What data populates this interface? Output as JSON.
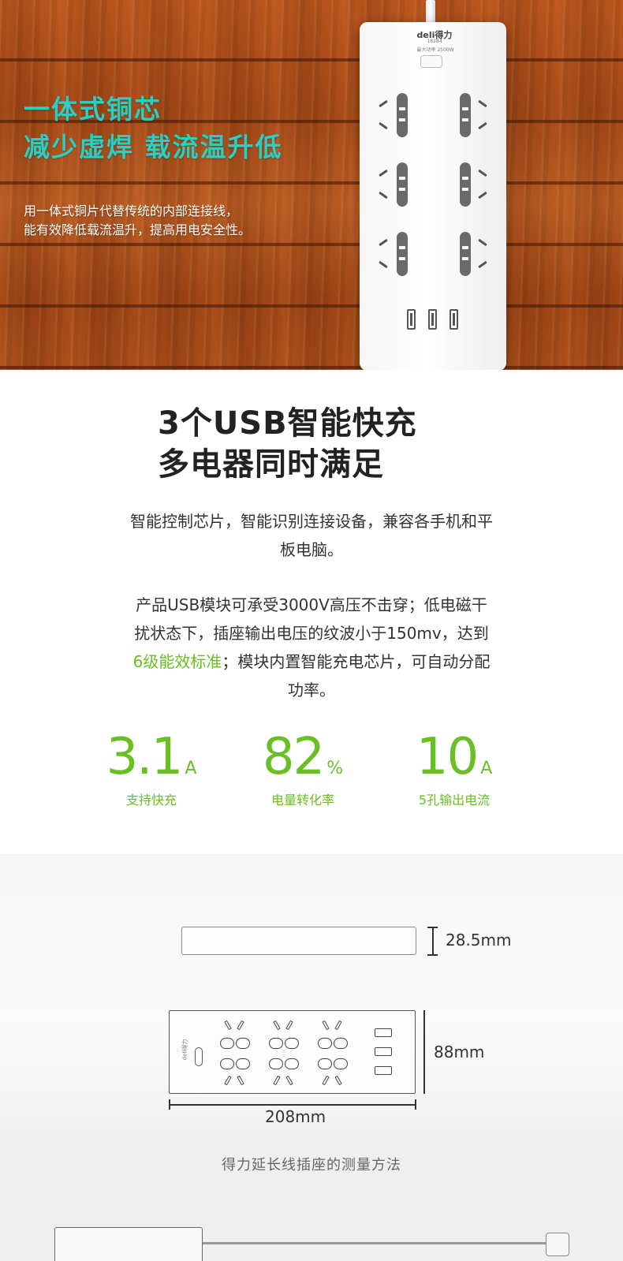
{
  "hero": {
    "headline_1": "一体式铜芯",
    "headline_2": "减少虚焊  载流温升低",
    "desc_1": "用一体式铜片代替传统的内部连接线，",
    "desc_2": "能有效降低载流温升，提高用电安全性。",
    "product": {
      "brand": "deli得力",
      "model": "18284",
      "power": "最大功率 2500W"
    },
    "colors": {
      "headline": "#26d0c4",
      "wood": "#b0501c"
    }
  },
  "usb_section": {
    "heading_1": "3个USB智能快充",
    "heading_2": "多电器同时满足",
    "para1_line1": "智能控制芯片，智能识别连接设备，兼容各手机和平",
    "para1_line2": "板电脑。",
    "para2_line1": "产品USB模块可承受3000V高压不击穿；低电磁干",
    "para2_line2": "扰状态下，插座输出电压的纹波小于150mv，达到",
    "para2_line3_highlight": "6级能效标准",
    "para2_line3_rest": "；模块内置智能充电芯片，可自动分配",
    "para2_line4": "功率。",
    "accent_color": "#6abf24",
    "stats": [
      {
        "value": "3.1",
        "unit": "A",
        "label": "支持快充"
      },
      {
        "value": "82",
        "unit": "%",
        "label": "电量转化率"
      },
      {
        "value": "10",
        "unit": "A",
        "label": "5孔输出电流"
      }
    ]
  },
  "dimensions": {
    "thickness": "28.5mm",
    "width": "88mm",
    "length": "208mm",
    "logo": "deli得力"
  },
  "measure": {
    "title": "得力延长线插座的测量方法"
  }
}
